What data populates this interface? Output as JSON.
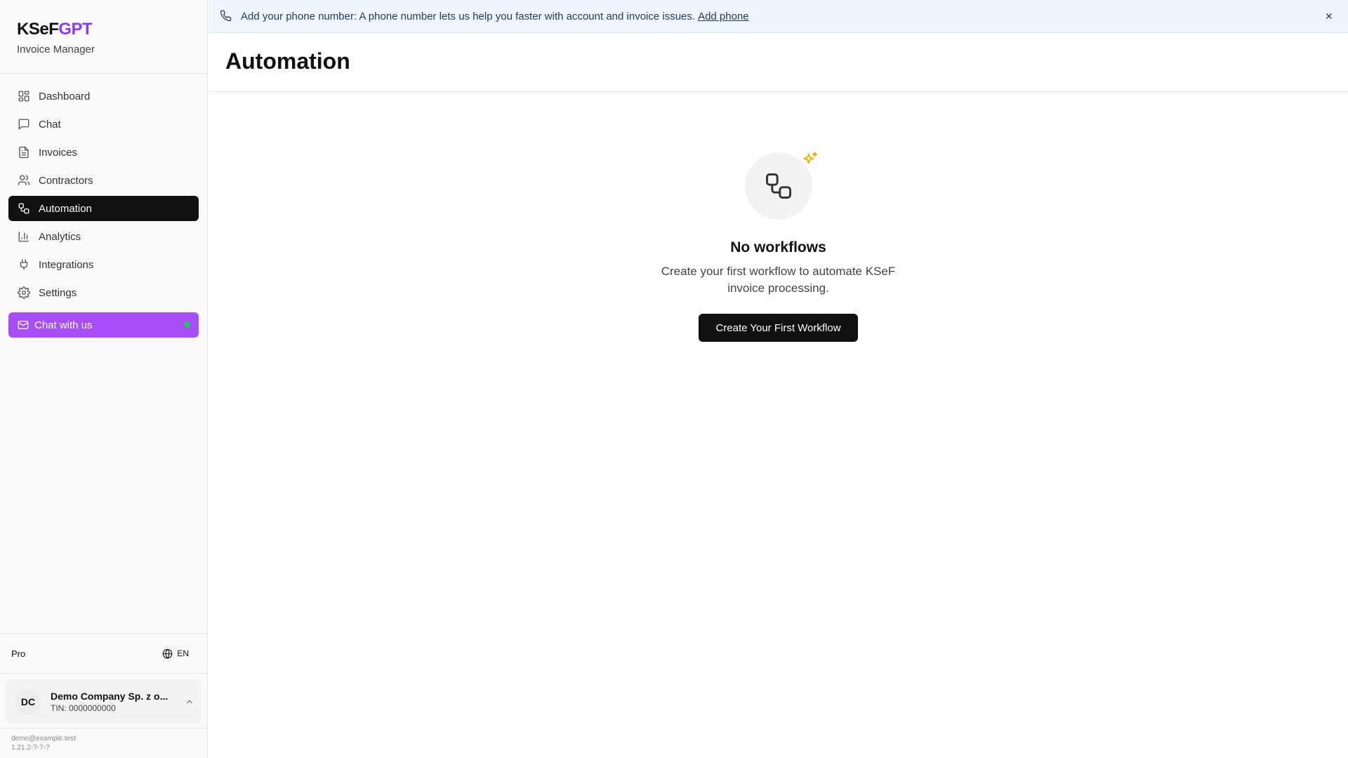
{
  "brand": {
    "title_part1": "KSeF",
    "title_part2": "GPT",
    "subtitle": "Invoice Manager"
  },
  "nav": {
    "items": [
      {
        "label": "Dashboard",
        "icon": "dashboard-icon"
      },
      {
        "label": "Chat",
        "icon": "chat-icon"
      },
      {
        "label": "Invoices",
        "icon": "invoice-icon"
      },
      {
        "label": "Contractors",
        "icon": "users-icon"
      },
      {
        "label": "Automation",
        "icon": "workflow-icon",
        "active": true
      },
      {
        "label": "Analytics",
        "icon": "bar-chart-icon"
      },
      {
        "label": "Integrations",
        "icon": "plug-icon"
      },
      {
        "label": "Settings",
        "icon": "gear-icon"
      }
    ],
    "chat_button_label": "Chat with us"
  },
  "sidebar_footer": {
    "plan": "Pro",
    "language": "EN",
    "company": {
      "initials": "DC",
      "name": "Demo Company Sp. z o...",
      "tin": "TIN: 0000000000"
    },
    "email": "demo@example.test",
    "version": "1.21.2-?-?-?"
  },
  "banner": {
    "text": "Add your phone number: A phone number lets us help you faster with account and invoice issues.",
    "link_label": "Add phone"
  },
  "page": {
    "title": "Automation"
  },
  "empty_state": {
    "title": "No workflows",
    "description": "Create your first workflow to automate KSeF invoice processing.",
    "button_label": "Create Your First Workflow"
  },
  "colors": {
    "brand_accent": "#8b3cf7",
    "chat_button": "#a74ef7",
    "online_dot": "#22c55e",
    "sparkle": "#eab308",
    "banner_bg": "#eff6ff"
  }
}
